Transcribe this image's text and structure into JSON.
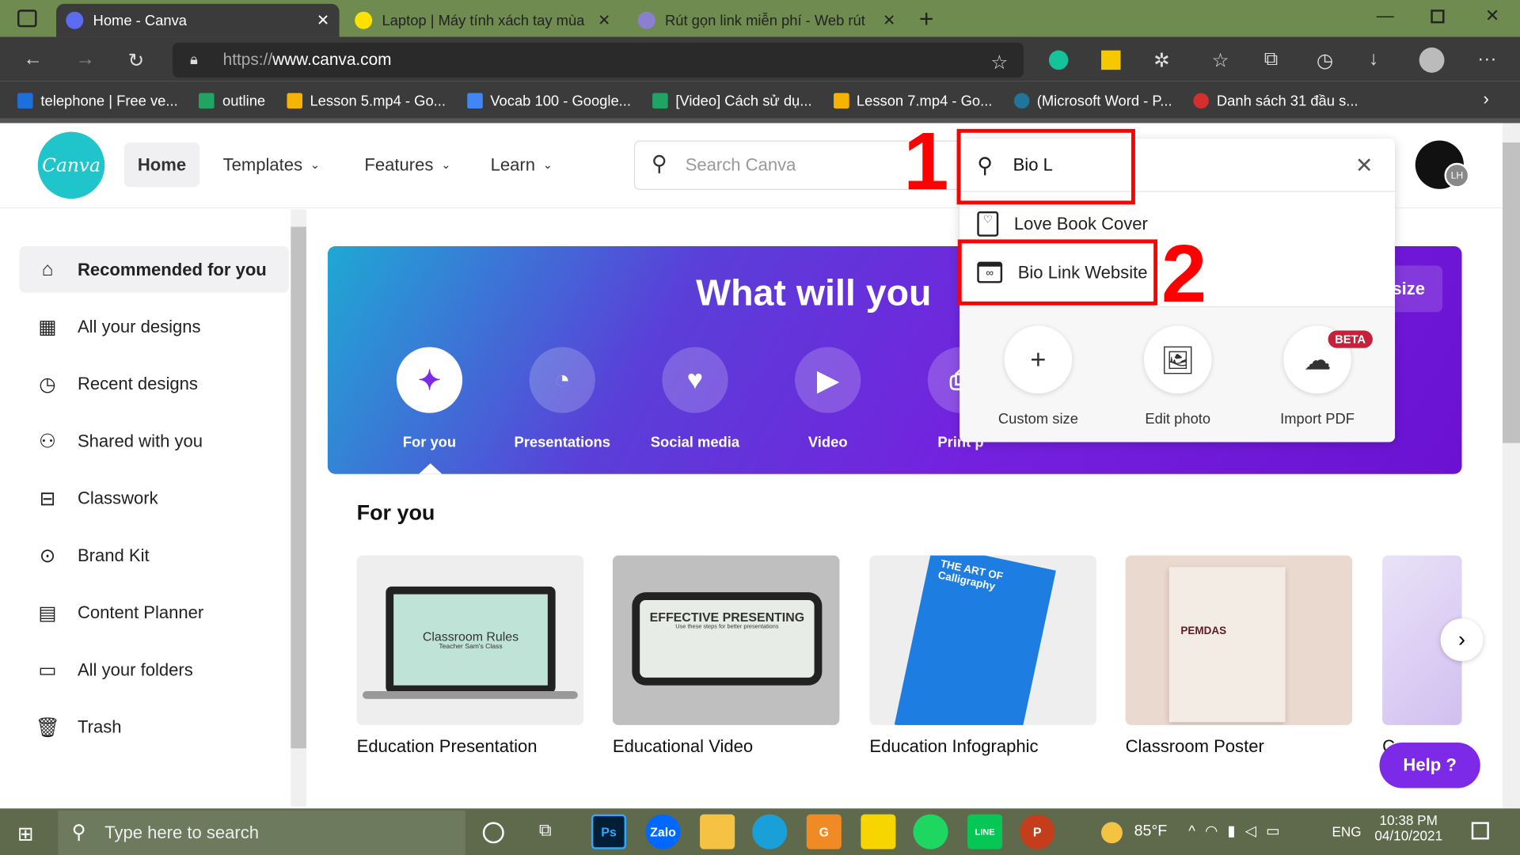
{
  "browser": {
    "tabs": [
      {
        "title": "Home - Canva",
        "favicon": "canva-icon"
      },
      {
        "title": "Laptop | Máy tính xách tay mùa t",
        "favicon": "site-icon"
      },
      {
        "title": "Rút gọn link miễn phí - Web rút",
        "favicon": "bitly-icon"
      }
    ],
    "url_prefix": "https://",
    "url_host": "www.canva.com",
    "bookmarks": [
      "telephone | Free ve...",
      "outline",
      "Lesson 5.mp4 - Go...",
      "Vocab 100 - Google...",
      "[Video] Cách sử dụ...",
      "Lesson 7.mp4 - Go...",
      "(Microsoft Word - P...",
      "Danh sách 31 đầu s..."
    ]
  },
  "header": {
    "logo": "Canva",
    "nav": [
      "Home",
      "Templates",
      "Features",
      "Learn"
    ],
    "search_placeholder": "Search Canva",
    "avatar_initials": "LH"
  },
  "sidebar": {
    "items": [
      "Recommended for you",
      "All your designs",
      "Recent designs",
      "Shared with you",
      "Classwork",
      "Brand Kit",
      "Content Planner",
      "All your folders",
      "Trash"
    ],
    "selected": 0
  },
  "banner": {
    "title": "What will you",
    "custom_size_partial": "size",
    "categories": [
      "For you",
      "Presentations",
      "Social media",
      "Video",
      "Print p"
    ]
  },
  "search_dropdown": {
    "query": "Bio L",
    "suggestions": [
      "Love Book Cover",
      "Bio Link Website"
    ],
    "quick_actions": [
      "Custom size",
      "Edit photo",
      "Import PDF"
    ],
    "beta_badge": "BETA"
  },
  "annotations": {
    "one": "1",
    "two": "2"
  },
  "for_you": {
    "heading": "For you",
    "cards": [
      {
        "title": "Education Presentation",
        "thumb_text": "Classroom Rules",
        "thumb_sub": "Teacher Sam's Class"
      },
      {
        "title": "Educational Video",
        "thumb_text": "EFFECTIVE PRESENTING",
        "thumb_sub": "Use these steps for better presentations"
      },
      {
        "title": "Education Infographic",
        "thumb_text": "THE ART OF Calligraphy"
      },
      {
        "title": "Classroom Poster",
        "thumb_text": "PEMDAS"
      },
      {
        "title": "C"
      }
    ]
  },
  "help": {
    "label": "Help ?"
  },
  "taskbar": {
    "search_placeholder": "Type here to search",
    "weather": "85°F",
    "lang": "ENG",
    "time": "10:38 PM",
    "date": "04/10/2021"
  },
  "colors": {
    "canva_purple": "#7d2ae8",
    "canva_teal": "#20c4cb",
    "annotation_red": "#ff0000"
  }
}
